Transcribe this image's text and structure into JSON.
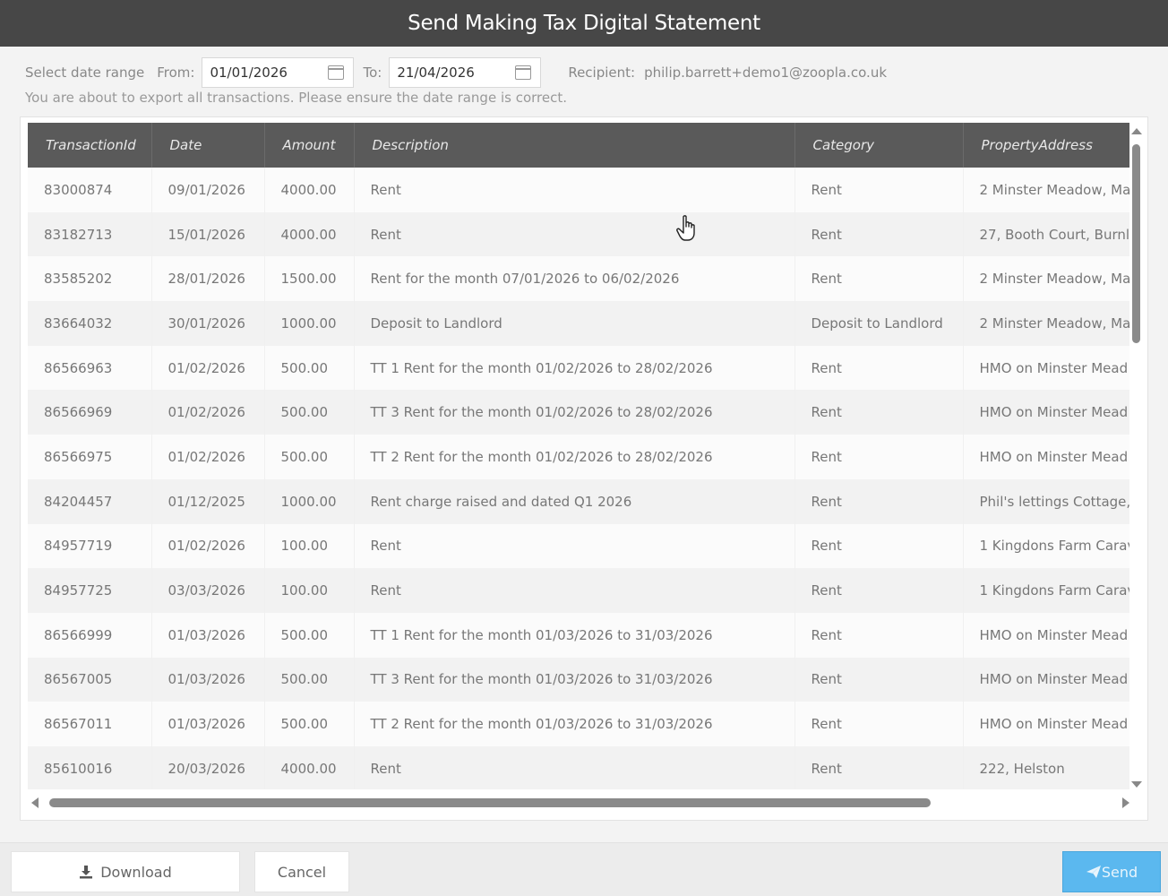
{
  "window": {
    "title": "Send Making Tax Digital Statement"
  },
  "filters": {
    "select_label": "Select date range",
    "from_label": "From:",
    "from_value": "01/01/2026",
    "to_label": "To:",
    "to_value": "21/04/2026",
    "recipient_label": "Recipient:",
    "recipient_value": "philip.barrett+demo1@zoopla.co.uk"
  },
  "notice": "You are about to export all transactions. Please ensure the date range is correct.",
  "table": {
    "columns": [
      "TransactionId",
      "Date",
      "Amount",
      "Description",
      "Category",
      "PropertyAddress"
    ],
    "rows": [
      [
        "83000874",
        "09/01/2026",
        "4000.00",
        "Rent",
        "Rent",
        "2 Minster Meadow, Ma"
      ],
      [
        "83182713",
        "15/01/2026",
        "4000.00",
        "Rent",
        "Rent",
        "27, Booth Court, Burnl"
      ],
      [
        "83585202",
        "28/01/2026",
        "1500.00",
        "Rent for the month 07/01/2026 to 06/02/2026",
        "Rent",
        "2 Minster Meadow, Ma"
      ],
      [
        "83664032",
        "30/01/2026",
        "1000.00",
        "Deposit to Landlord",
        "Deposit to Landlord",
        "2 Minster Meadow, Ma"
      ],
      [
        "86566963",
        "01/02/2026",
        "500.00",
        "TT 1 Rent for the month 01/02/2026 to 28/02/2026",
        "Rent",
        "HMO on Minster Mead"
      ],
      [
        "86566969",
        "01/02/2026",
        "500.00",
        "TT 3 Rent for the month 01/02/2026 to 28/02/2026",
        "Rent",
        "HMO on Minster Mead"
      ],
      [
        "86566975",
        "01/02/2026",
        "500.00",
        "TT 2 Rent for the month 01/02/2026 to 28/02/2026",
        "Rent",
        "HMO on Minster Mead"
      ],
      [
        "84204457",
        "01/12/2025",
        "1000.00",
        "Rent charge raised and dated Q1 2026",
        "Rent",
        "Phil's lettings Cottage,"
      ],
      [
        "84957719",
        "01/02/2026",
        "100.00",
        "Rent",
        "Rent",
        "1 Kingdons Farm Carav"
      ],
      [
        "84957725",
        "03/03/2026",
        "100.00",
        "Rent",
        "Rent",
        "1 Kingdons Farm Carav"
      ],
      [
        "86566999",
        "01/03/2026",
        "500.00",
        "TT 1 Rent for the month 01/03/2026 to 31/03/2026",
        "Rent",
        "HMO on Minster Mead"
      ],
      [
        "86567005",
        "01/03/2026",
        "500.00",
        "TT 3 Rent for the month 01/03/2026 to 31/03/2026",
        "Rent",
        "HMO on Minster Mead"
      ],
      [
        "86567011",
        "01/03/2026",
        "500.00",
        "TT 2 Rent for the month 01/03/2026 to 31/03/2026",
        "Rent",
        "HMO on Minster Mead"
      ],
      [
        "85610016",
        "20/03/2026",
        "4000.00",
        "Rent",
        "Rent",
        "222, Helston"
      ]
    ]
  },
  "footer": {
    "download_label": "Download",
    "cancel_label": "Cancel",
    "send_label": "Send"
  },
  "icons": {
    "download": "download-icon",
    "send": "paper-plane-icon",
    "calendar": "calendar-icon",
    "cursor": "hand-pointer-icon"
  },
  "colors": {
    "titlebar": "#474747",
    "header": "#5a5a5a",
    "send_button": "#5bb8ef"
  }
}
